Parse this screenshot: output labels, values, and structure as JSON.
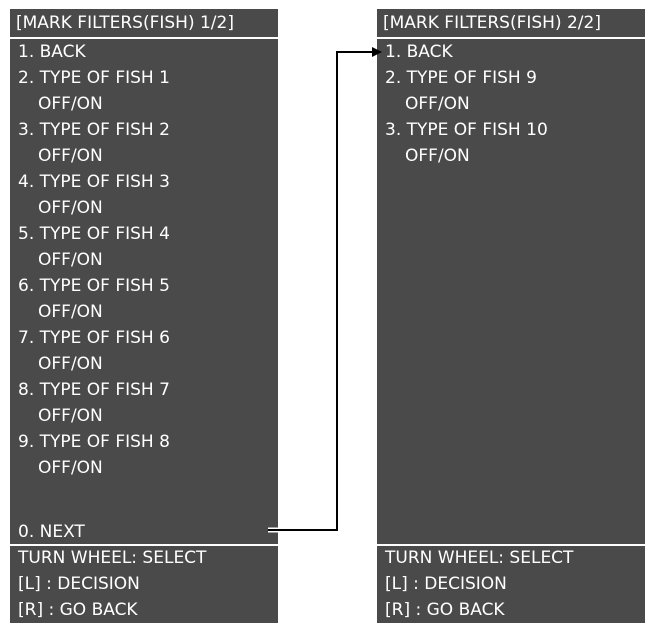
{
  "panel1": {
    "title": "[MARK FILTERS(FISH) 1/2]",
    "items": [
      {
        "label": "1. BACK"
      },
      {
        "label": "2. TYPE OF FISH 1",
        "sub": "OFF/ON"
      },
      {
        "label": "3. TYPE OF FISH 2",
        "sub": "OFF/ON"
      },
      {
        "label": "4. TYPE OF FISH 3",
        "sub": "OFF/ON"
      },
      {
        "label": "5. TYPE OF FISH 4",
        "sub": "OFF/ON"
      },
      {
        "label": "6. TYPE OF FISH 5",
        "sub": "OFF/ON"
      },
      {
        "label": "7. TYPE OF FISH 6",
        "sub": "OFF/ON"
      },
      {
        "label": "8. TYPE OF FISH 7",
        "sub": "OFF/ON"
      },
      {
        "label": "9. TYPE OF FISH 8",
        "sub": "OFF/ON"
      }
    ],
    "next": "0. NEXT",
    "footer": [
      "TURN WHEEL: SELECT",
      "[L] : DECISION",
      "[R] : GO BACK"
    ]
  },
  "panel2": {
    "title": "[MARK FILTERS(FISH) 2/2]",
    "items": [
      {
        "label": "1. BACK"
      },
      {
        "label": "2. TYPE OF FISH 9",
        "sub": "OFF/ON"
      },
      {
        "label": "3. TYPE OF FISH 10",
        "sub": "OFF/ON"
      }
    ],
    "footer": [
      "TURN WHEEL: SELECT",
      "[L] : DECISION",
      "[R] : GO BACK"
    ]
  },
  "colors": {
    "panel_bg": "#4a4a4a",
    "text": "#ffffff",
    "connector": "#000000"
  }
}
